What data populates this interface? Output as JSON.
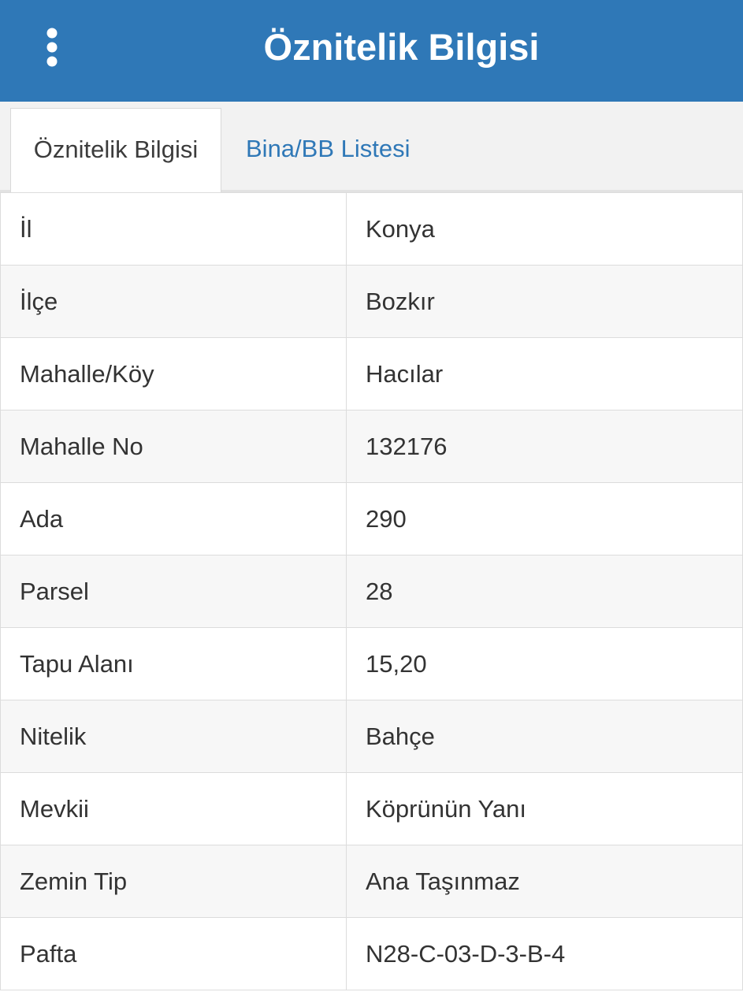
{
  "header": {
    "title": "Öznitelik Bilgisi",
    "menu_icon": "more-vertical-icon",
    "color": "#2f78b7"
  },
  "tabs": [
    {
      "label": "Öznitelik Bilgisi",
      "active": true
    },
    {
      "label": "Bina/BB Listesi",
      "active": false
    }
  ],
  "rows": [
    {
      "key": "İl",
      "value": "Konya"
    },
    {
      "key": "İlçe",
      "value": "Bozkır"
    },
    {
      "key": "Mahalle/Köy",
      "value": "Hacılar"
    },
    {
      "key": "Mahalle No",
      "value": "132176"
    },
    {
      "key": "Ada",
      "value": "290"
    },
    {
      "key": "Parsel",
      "value": "28"
    },
    {
      "key": "Tapu Alanı",
      "value": "15,20"
    },
    {
      "key": "Nitelik",
      "value": "Bahçe"
    },
    {
      "key": "Mevkii",
      "value": "Köprünün Yanı"
    },
    {
      "key": "Zemin Tip",
      "value": "Ana Taşınmaz"
    },
    {
      "key": "Pafta",
      "value": "N28-C-03-D-3-B-4"
    }
  ]
}
